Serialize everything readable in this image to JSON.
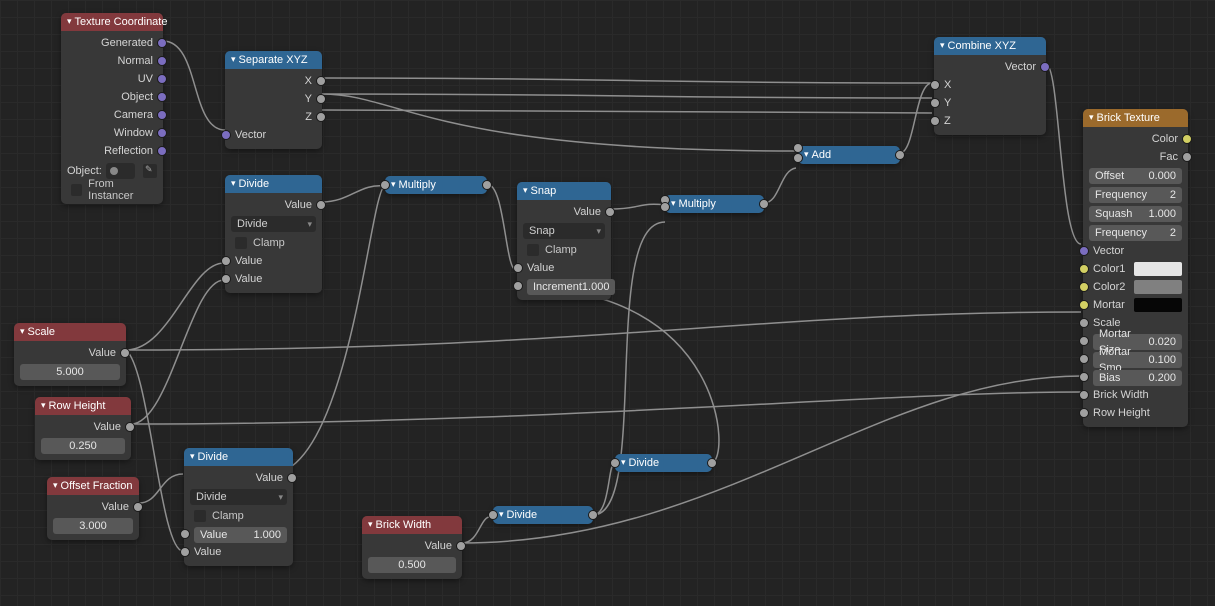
{
  "nodes": {
    "texcoord": {
      "title": "Texture Coordinate",
      "outputs": [
        "Generated",
        "Normal",
        "UV",
        "Object",
        "Camera",
        "Window",
        "Reflection"
      ],
      "object_label": "Object:",
      "from_instancer": "From Instancer"
    },
    "sepxyz": {
      "title": "Separate XYZ",
      "outputs": [
        "X",
        "Y",
        "Z"
      ],
      "input": "Vector"
    },
    "combinexyz": {
      "title": "Combine XYZ",
      "output": "Vector",
      "inputs": [
        "X",
        "Y",
        "Z"
      ]
    },
    "divide1": {
      "title": "Divide",
      "output": "Value",
      "mode": "Divide",
      "clamp": "Clamp",
      "in1": "Value",
      "in2": "Value"
    },
    "multiply1": {
      "title": "Multiply"
    },
    "snap": {
      "title": "Snap",
      "output": "Value",
      "mode": "Snap",
      "clamp": "Clamp",
      "in1": "Value",
      "increment_label": "Increment",
      "increment_val": "1.000"
    },
    "multiply2": {
      "title": "Multiply"
    },
    "add": {
      "title": "Add"
    },
    "scale": {
      "title": "Scale",
      "out": "Value",
      "val": "5.000"
    },
    "rowheight": {
      "title": "Row Height",
      "out": "Value",
      "val": "0.250"
    },
    "offsetfrac": {
      "title": "Offset Fraction",
      "out": "Value",
      "val": "3.000"
    },
    "divide2": {
      "title": "Divide",
      "output": "Value",
      "mode": "Divide",
      "clamp": "Clamp",
      "value_label": "Value",
      "value_val": "1.000",
      "in2": "Value"
    },
    "divide3": {
      "title": "Divide"
    },
    "divide4": {
      "title": "Divide"
    },
    "brickwidth": {
      "title": "Brick Width",
      "out": "Value",
      "val": "0.500"
    },
    "bricktex": {
      "title": "Brick Texture",
      "out_color": "Color",
      "out_fac": "Fac",
      "offset_label": "Offset",
      "offset_val": "0.000",
      "freq1_label": "Frequency",
      "freq1_val": "2",
      "squash_label": "Squash",
      "squash_val": "1.000",
      "freq2_label": "Frequency",
      "freq2_val": "2",
      "vector": "Vector",
      "color1": "Color1",
      "color2": "Color2",
      "mortar": "Mortar",
      "scale": "Scale",
      "mortar_size_label": "Mortar Size",
      "mortar_size_val": "0.020",
      "mortar_smo_label": "Mortar Smo",
      "mortar_smo_val": "0.100",
      "bias_label": "Bias",
      "bias_val": "0.200",
      "brick_width": "Brick Width",
      "row_height": "Row Height",
      "swatch_c1": "#e6e6e6",
      "swatch_c2": "#808080",
      "swatch_m": "#060606"
    }
  }
}
